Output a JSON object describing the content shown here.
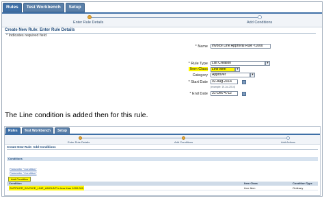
{
  "top": {
    "tabs": [
      "Rules",
      "Test Workbench",
      "Setup"
    ],
    "train": {
      "steps": [
        "Enter Rule Details",
        "Add Conditions"
      ]
    },
    "page_title": "Create New Rule: Enter Rule Details",
    "required_note": "* Indicates required field",
    "fields": {
      "name_label": "* Name",
      "name_value": "Invoice Line Approval Rule <1000",
      "rule_type_label": "* Rule Type",
      "rule_type_value": "List Creation",
      "item_class_label": "Item Class",
      "item_class_value": "Line Item",
      "category_label": "Category",
      "category_value": "Approver",
      "start_date_label": "* Start Date",
      "start_date_value": "02-Aug-2014",
      "start_date_hint": "(example: 19-Jul-2014)",
      "end_date_label": "* End Date",
      "end_date_value": "31-Dec-4712"
    },
    "colors": {
      "accent": "#3e6fa6",
      "highlight": "#fff700",
      "train_done": "#e3a73a"
    }
  },
  "caption": "The Line condition is added then for this rule.",
  "bottom": {
    "tabs": [
      "Rules",
      "Test Workbench",
      "Setup"
    ],
    "train": {
      "steps": [
        "Enter Rule Details",
        "Add Conditions",
        "Add Actions"
      ]
    },
    "page_title": "Create New Rule: Add Conditions",
    "conditions_header": "Conditions",
    "links": [
      "Parameter \"Condition\"",
      "Parameter \"Condition\""
    ],
    "add_condition_button": "Add Condition",
    "table": {
      "headers": [
        "Condition",
        "Item Class",
        "Condition Type"
      ],
      "rows": [
        [
          "SUPPLIER_INVOICE_LINE_AMOUNT is less than 1000.000",
          "Line Item",
          "Ordinary"
        ]
      ]
    }
  }
}
